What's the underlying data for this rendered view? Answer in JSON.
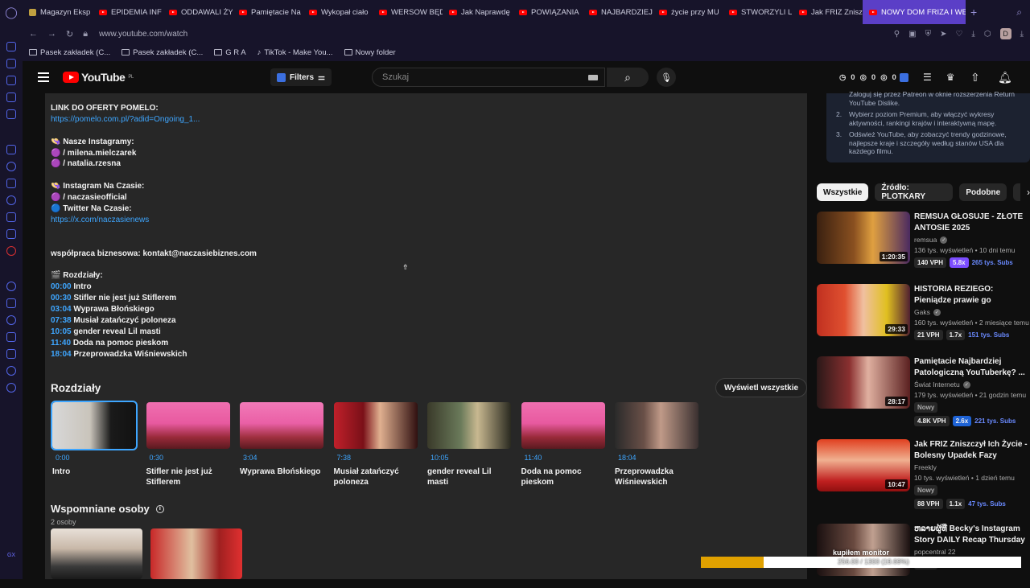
{
  "browser": {
    "tabs": [
      {
        "label": "Magazyn Eksp",
        "yt": false
      },
      {
        "label": "EPIDEMIA INF",
        "yt": true
      },
      {
        "label": "ODDAWALI ŻY",
        "yt": true
      },
      {
        "label": "Pamiętacie Na",
        "yt": true
      },
      {
        "label": "Wykopał ciało",
        "yt": true
      },
      {
        "label": "WERSOW BĘD",
        "yt": true
      },
      {
        "label": "Jak Naprawdę",
        "yt": true
      },
      {
        "label": "POWIĄZANIA",
        "yt": true
      },
      {
        "label": "NAJBARDZIEJ",
        "yt": true
      },
      {
        "label": "życie przy MU",
        "yt": true
      },
      {
        "label": "STWORZYLI LI",
        "yt": true
      },
      {
        "label": "Jak FRIZ Znisz",
        "yt": true
      },
      {
        "label": "NOWY DOM FRIZA I WER",
        "yt": true
      }
    ],
    "url": "www.youtube.com/watch",
    "profile_letter": "D",
    "bookmarks": [
      "Pasek zakładek (C...",
      "Pasek zakładek (C...",
      "G R A",
      "TikTok - Make You...",
      "Nowy folder"
    ]
  },
  "yt_header": {
    "logo_text": "YouTube",
    "logo_region": "PL",
    "filters_label": "Filters",
    "search_placeholder": "Szukaj",
    "stats": [
      "0",
      "0",
      "0"
    ]
  },
  "description": {
    "lines": [
      {
        "text": "LINK DO OFERTY POMELO:",
        "link": false
      },
      {
        "text": "https://pomelo.com.pl/?adid=Ongoing_1...",
        "link": true
      },
      {
        "text": "",
        "link": false
      },
      {
        "text": "👒 Nasze Instagramy:",
        "link": false
      },
      {
        "text": "🟣 / milena.mielczarek",
        "link": false
      },
      {
        "text": "🟣 / natalia.rzesna",
        "link": false
      },
      {
        "text": "",
        "link": false
      },
      {
        "text": "👒 Instagram Na Czasie:",
        "link": false
      },
      {
        "text": "🟣 / naczasieofficial",
        "link": false
      },
      {
        "text": "🔵 Twitter Na Czasie:",
        "link": false
      },
      {
        "text": "https://x.com/naczasienews",
        "link": true
      },
      {
        "text": "",
        "link": false
      },
      {
        "text": "",
        "link": false
      },
      {
        "text": "współpraca biznesowa: kontakt@naczasiebiznes.com",
        "link": false
      },
      {
        "text": "",
        "link": false
      },
      {
        "text": "🎬 Rozdziały:",
        "link": false
      }
    ],
    "chapters_text": [
      {
        "time": "00:00",
        "label": "Intro"
      },
      {
        "time": "00:30",
        "label": "Stifler nie jest już Stiflerem"
      },
      {
        "time": "03:04",
        "label": "Wyprawa Błońskiego"
      },
      {
        "time": "07:38",
        "label": "Musiał zatańczyć poloneza"
      },
      {
        "time": "10:05",
        "label": "gender reveal Lil masti"
      },
      {
        "time": "11:40",
        "label": "Doda na pomoc pieskom"
      },
      {
        "time": "18:04",
        "label": "Przeprowadzka Wiśniewskich"
      }
    ]
  },
  "chapters": {
    "title": "Rozdziały",
    "show_all": "Wyświetl wszystkie",
    "items": [
      {
        "time": "0:00",
        "name": "Intro",
        "bg": "linear-gradient(90deg,#d8d8d8 0%,#c9c4bb 45%,#1a1a1a 70%,#111 100%)"
      },
      {
        "time": "0:30",
        "name": "Stifler nie jest już Stiflerem",
        "bg": "linear-gradient(180deg,#f06fb0 0%,#e85aa0 45%,#9a2a3a 75%,#5a1a20 100%)"
      },
      {
        "time": "3:04",
        "name": "Wyprawa Błońskiego",
        "bg": "linear-gradient(180deg,#f27ab8 0%,#ea60a6 45%,#a0303f 75%,#5a1a20 100%)"
      },
      {
        "time": "7:38",
        "name": "Musiał zatańczyć poloneza",
        "bg": "linear-gradient(90deg,#c0202a 0%,#7a1018 35%,#e0b090 55%,#301010 100%)"
      },
      {
        "time": "10:05",
        "name": "gender reveal Lil masti",
        "bg": "linear-gradient(90deg,#3a3a2a 0%,#6a7a5a 40%,#c8b890 60%,#2a2a20 100%)"
      },
      {
        "time": "11:40",
        "name": "Doda na pomoc pieskom",
        "bg": "linear-gradient(180deg,#f06fb0 0%,#e85aa0 45%,#9a2a3a 75%,#5a1a20 100%)"
      },
      {
        "time": "18:04",
        "name": "Przeprowadzka Wiśniewskich",
        "bg": "linear-gradient(90deg,#2a2a2a 0%,#6a5048 35%,#c09a88 55%,#3a3030 100%)"
      }
    ]
  },
  "mentioned": {
    "title": "Wspomniane osoby",
    "count": "2 osoby"
  },
  "right_panel": {
    "info_items": [
      {
        "num": "",
        "text": "Zaloguj się przez Patreon w oknie rozszerzenia Return YouTube Dislike."
      },
      {
        "num": "2.",
        "text": "Wybierz poziom Premium, aby włączyć wykresy aktywności, rankingi krajów i interaktywną mapę."
      },
      {
        "num": "3.",
        "text": "Odśwież YouTube, aby zobaczyć trendy godzinowe, najlepsze kraje i szczegóły według stanów USA dla każdego filmu."
      }
    ],
    "chips": [
      "Wszystkie",
      "Źródło: PLOTKARY",
      "Podobne"
    ],
    "videos": [
      {
        "title": "REMSUA GŁOSUJE - ZŁOTE ANTOSIE 2025",
        "channel": "remsua",
        "verified": true,
        "views": "136 tys. wyświetleń • 10 dni temu",
        "duration": "1:20:35",
        "vph": "140 VPH",
        "mult": "5.8x",
        "mult_color": "pu",
        "subs": "265 tys. Subs",
        "nowy": false,
        "bg": "linear-gradient(90deg,#3a2010 0%,#8a5020 40%,#e0a040 60%,#4a2a60 100%)"
      },
      {
        "title": "HISTORIA REZIEGO: Pieniądze prawie go Zniszczyły",
        "channel": "Gaks",
        "verified": true,
        "views": "160 tys. wyświetleń • 2 miesiące temu",
        "duration": "29:33",
        "vph": "21 VPH",
        "mult": "1.7x",
        "mult_color": "",
        "subs": "151 tys. Subs",
        "nowy": false,
        "bg": "linear-gradient(90deg,#c03020 0%,#e05030 30%,#f0c0a0 50%,#e0c020 75%,#502030 100%)"
      },
      {
        "title": "Pamiętacie Najbardziej Patologiczną YouTuberkę? ...",
        "channel": "Świat Internetu",
        "verified": true,
        "views": "179 tys. wyświetleń • 21 godzin temu",
        "duration": "28:17",
        "vph": "4.8K VPH",
        "mult": "2.6x",
        "mult_color": "bl",
        "subs": "221 tys. Subs",
        "nowy": true,
        "bg": "linear-gradient(90deg,#2a1818 0%,#8a3030 35%,#e0b0a0 55%,#5a2020 100%)"
      },
      {
        "title": "Jak FRIZ Zniszczył Ich Życie - Bolesny Upadek Fazy",
        "channel": "Freekly",
        "verified": false,
        "views": "10 tys. wyświetleń • 1 dzień temu",
        "duration": "10:47",
        "vph": "88 VPH",
        "mult": "1.1x",
        "mult_color": "",
        "subs": "47 tys. Subs",
        "nowy": true,
        "bg": "linear-gradient(180deg,#e04020 0%,#f0b090 40%,#c02020 80%,#901010 100%)"
      },
      {
        "title": "ຫລາຍຜູ້ທີ່ Becky's Instagram Story DAILY Recap Thursday ...",
        "channel": "popcentral 22",
        "verified": false,
        "views": "",
        "duration": "",
        "vph": "",
        "mult": "",
        "mult_color": "",
        "subs": "",
        "nowy": true,
        "bg": "linear-gradient(90deg,#1a1010 0%,#6a4a40 40%,#c0a090 60%,#1a1010 100%)"
      }
    ]
  },
  "overlay": {
    "caption": "kupiłem monitor",
    "progress_text": "256.00 / 1300 (19.69%)",
    "progress_fraction": 0.197
  }
}
